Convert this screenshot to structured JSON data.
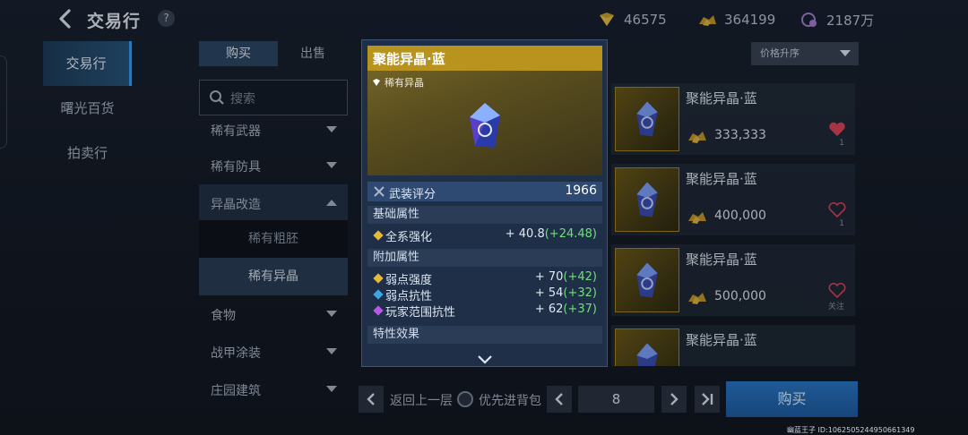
{
  "header": {
    "title": "交易行",
    "help": "?",
    "currencies": [
      {
        "icon": "gem-currency-icon",
        "value": "46575"
      },
      {
        "icon": "gold-ore-icon",
        "value": "364199"
      },
      {
        "icon": "coin-bag-icon",
        "value": "2187万"
      }
    ]
  },
  "nav": {
    "items": [
      "交易行",
      "曙光百货",
      "拍卖行"
    ],
    "active": "交易行"
  },
  "market": {
    "tabs": {
      "buy": "购买",
      "sell": "出售"
    },
    "search_placeholder": "搜索",
    "categories": [
      {
        "label": "稀有武器"
      },
      {
        "label": "稀有防具"
      },
      {
        "label": "异晶改造"
      },
      {
        "label": "食物"
      },
      {
        "label": "战甲涂装"
      },
      {
        "label": "庄园建筑"
      }
    ],
    "subcategories": [
      "稀有粗胚",
      "稀有异晶"
    ],
    "selected_subcategory": "稀有异晶",
    "sort": {
      "label": "价格升序"
    }
  },
  "listings": [
    {
      "name": "聚能异晶·蓝",
      "price": "333,333",
      "fav_count": "1",
      "favorited": true
    },
    {
      "name": "聚能异晶·蓝",
      "price": "400,000",
      "fav_count": "1",
      "favorited": false
    },
    {
      "name": "聚能异晶·蓝",
      "price": "500,000",
      "fav_count": "关注",
      "favorited": false
    },
    {
      "name": "聚能异晶·蓝",
      "price": "",
      "fav_count": "",
      "favorited": false
    }
  ],
  "footer": {
    "back_label": "返回上一层",
    "priority_label": "优先进背包",
    "page": "8",
    "buy_label": "购买",
    "uid_text": "幽蓝王子 ID:1062505244950661349"
  },
  "tooltip": {
    "title": "聚能异晶·蓝",
    "rarity": "稀有异晶",
    "score_label": "武装评分",
    "score_value": "1966",
    "base_header": "基础属性",
    "base_attrs": [
      {
        "label": "全系强化",
        "value": "+ 40.8",
        "bonus": "(+24.48)",
        "color": "#e6b93a"
      }
    ],
    "extra_header": "附加属性",
    "extra_attrs": [
      {
        "label": "弱点强度",
        "value": "+ 70",
        "bonus": "(+42)",
        "color": "#e6b93a"
      },
      {
        "label": "弱点抗性",
        "value": "+ 54",
        "bonus": "(+32)",
        "color": "#3aa6e6"
      },
      {
        "label": "玩家范围抗性",
        "value": "+ 62",
        "bonus": "(+37)",
        "color": "#b65ae6"
      }
    ],
    "trait_header": "特性效果"
  },
  "colors": {
    "accent_blue": "#2a78c8",
    "gold_rarity": "#b8941f",
    "bonus_green": "#6ee07a",
    "heart_red": "#e0455a"
  }
}
